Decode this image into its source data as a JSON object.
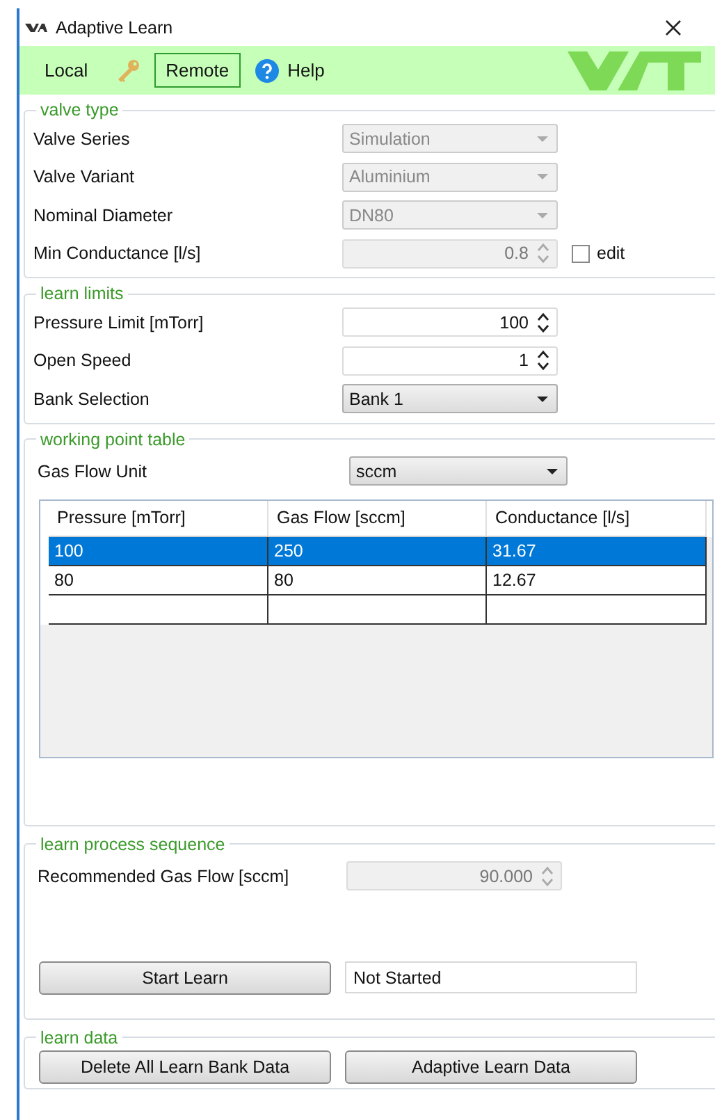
{
  "window": {
    "title": "Adaptive Learn"
  },
  "toolbar": {
    "modes": [
      {
        "label": "Local",
        "selected": false
      },
      {
        "label": "Remote",
        "selected": true
      }
    ],
    "help": "Help"
  },
  "valve_type": {
    "title": "valve type",
    "fields": [
      {
        "kind": "combo",
        "label": "Valve Series",
        "value": "Simulation",
        "disabled": true
      },
      {
        "kind": "combo",
        "label": "Valve Variant",
        "value": "Aluminium",
        "disabled": true
      },
      {
        "kind": "combo",
        "label": "Nominal Diameter",
        "value": "DN80",
        "disabled": true
      },
      {
        "kind": "spin",
        "label": "Min Conductance [l/s]",
        "value": "0.8",
        "disabled": true,
        "option": {
          "label": "edit",
          "checked": false
        }
      }
    ]
  },
  "learn_limits": {
    "title": "learn limits",
    "fields": [
      {
        "kind": "spin",
        "label": "Pressure Limit [mTorr]",
        "value": "100",
        "disabled": false
      },
      {
        "kind": "spin",
        "label": "Open Speed",
        "value": "1",
        "disabled": false
      },
      {
        "kind": "combo",
        "label": "Bank Selection",
        "value": "Bank 1",
        "disabled": false
      }
    ]
  },
  "working_point_table": {
    "title": "working point table",
    "unit": {
      "label": "Gas Flow Unit",
      "value": "sccm",
      "disabled": false
    },
    "columns": [
      "Pressure [mTorr]",
      "Gas Flow [sccm]",
      "Conductance [l/s]"
    ],
    "rows": [
      {
        "cells": [
          "100",
          "250",
          "31.67"
        ],
        "selected": true
      },
      {
        "cells": [
          "80",
          "80",
          "12.67"
        ],
        "selected": false
      }
    ]
  },
  "learn_process_sequence": {
    "title": "learn process sequence",
    "recommended": {
      "label": "Recommended Gas Flow [sccm]",
      "value": "90.000",
      "disabled": true
    },
    "start_button": "Start Learn",
    "status": "Not Started"
  },
  "learn_data": {
    "title": "learn data",
    "buttons": [
      "Delete All Learn Bank Data",
      "Adaptive Learn Data"
    ]
  }
}
